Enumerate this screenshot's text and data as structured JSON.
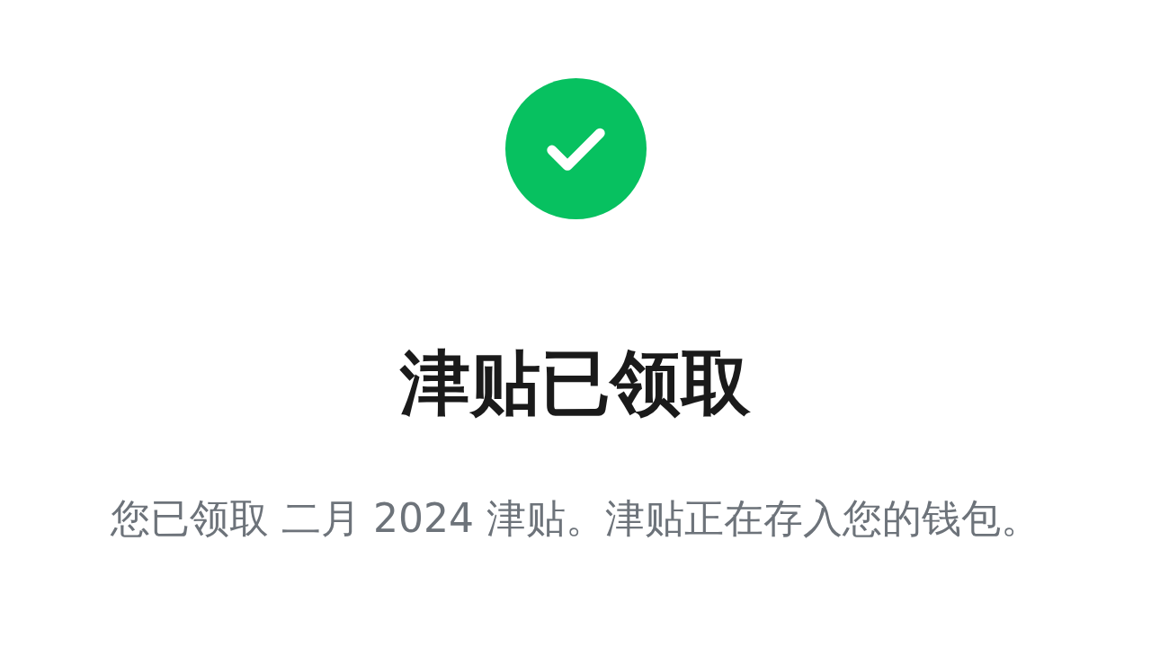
{
  "status": {
    "kind": "success"
  },
  "title": "津贴已领取",
  "message": "您已领取 二月 2024 津贴。津贴正在存入您的钱包。"
}
